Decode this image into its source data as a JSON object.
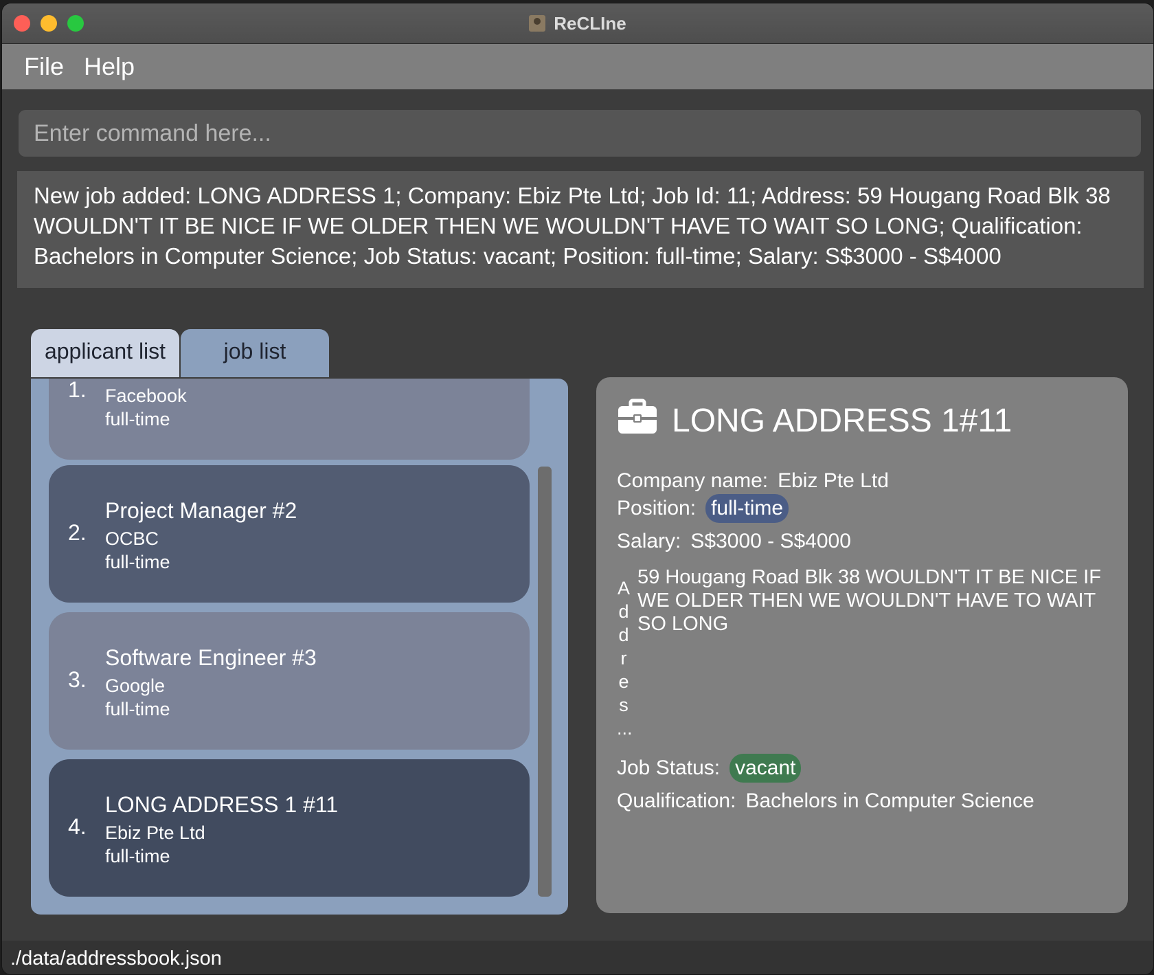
{
  "window": {
    "title": "ReCLIne"
  },
  "menu": {
    "file": "File",
    "help": "Help"
  },
  "command": {
    "placeholder": "Enter command here..."
  },
  "result": {
    "message": "New job added: LONG ADDRESS 1; Company: Ebiz Pte Ltd; Job Id: 11; Address: 59 Hougang Road Blk 38 WOULDN'T IT BE NICE IF WE OLDER THEN WE WOULDN'T HAVE TO WAIT SO LONG; Qualification: Bachelors in Computer Science; Job Status: vacant; Position: full-time; Salary: S$3000 - S$4000"
  },
  "tabs": {
    "applicant": "applicant list",
    "job": "job list"
  },
  "jobs": [
    {
      "index": "1.",
      "title": "",
      "company": "Facebook",
      "position": "full-time"
    },
    {
      "index": "2.",
      "title": "Project Manager  #2",
      "company": "OCBC",
      "position": "full-time"
    },
    {
      "index": "3.",
      "title": "Software Engineer  #3",
      "company": "Google",
      "position": "full-time"
    },
    {
      "index": "4.",
      "title": "LONG ADDRESS 1  #11",
      "company": "Ebiz Pte Ltd",
      "position": "full-time"
    }
  ],
  "detail": {
    "title": "LONG ADDRESS 1#11",
    "company_label": "Company name:",
    "company": "Ebiz Pte Ltd",
    "position_label": "Position:",
    "position": "full-time",
    "salary_label": "Salary:",
    "salary": "S$3000 - S$4000",
    "address_label_chars": [
      "A",
      "d",
      "d",
      "r",
      "e",
      "s",
      "..."
    ],
    "address": "59 Hougang Road Blk 38 WOULDN'T IT BE NICE IF WE OLDER THEN WE WOULDN'T HAVE TO WAIT SO LONG",
    "status_label": "Job Status:",
    "status": "vacant",
    "qualification_label": "Qualification:",
    "qualification": "Bachelors in Computer Science"
  },
  "status_bar": {
    "path": "./data/addressbook.json"
  },
  "colors": {
    "tab_active": "#cdd5e4",
    "list_bg": "#8ba0bd",
    "detail_bg": "#808080",
    "position_pill": "#4b5d86",
    "status_pill": "#3f7a50"
  }
}
